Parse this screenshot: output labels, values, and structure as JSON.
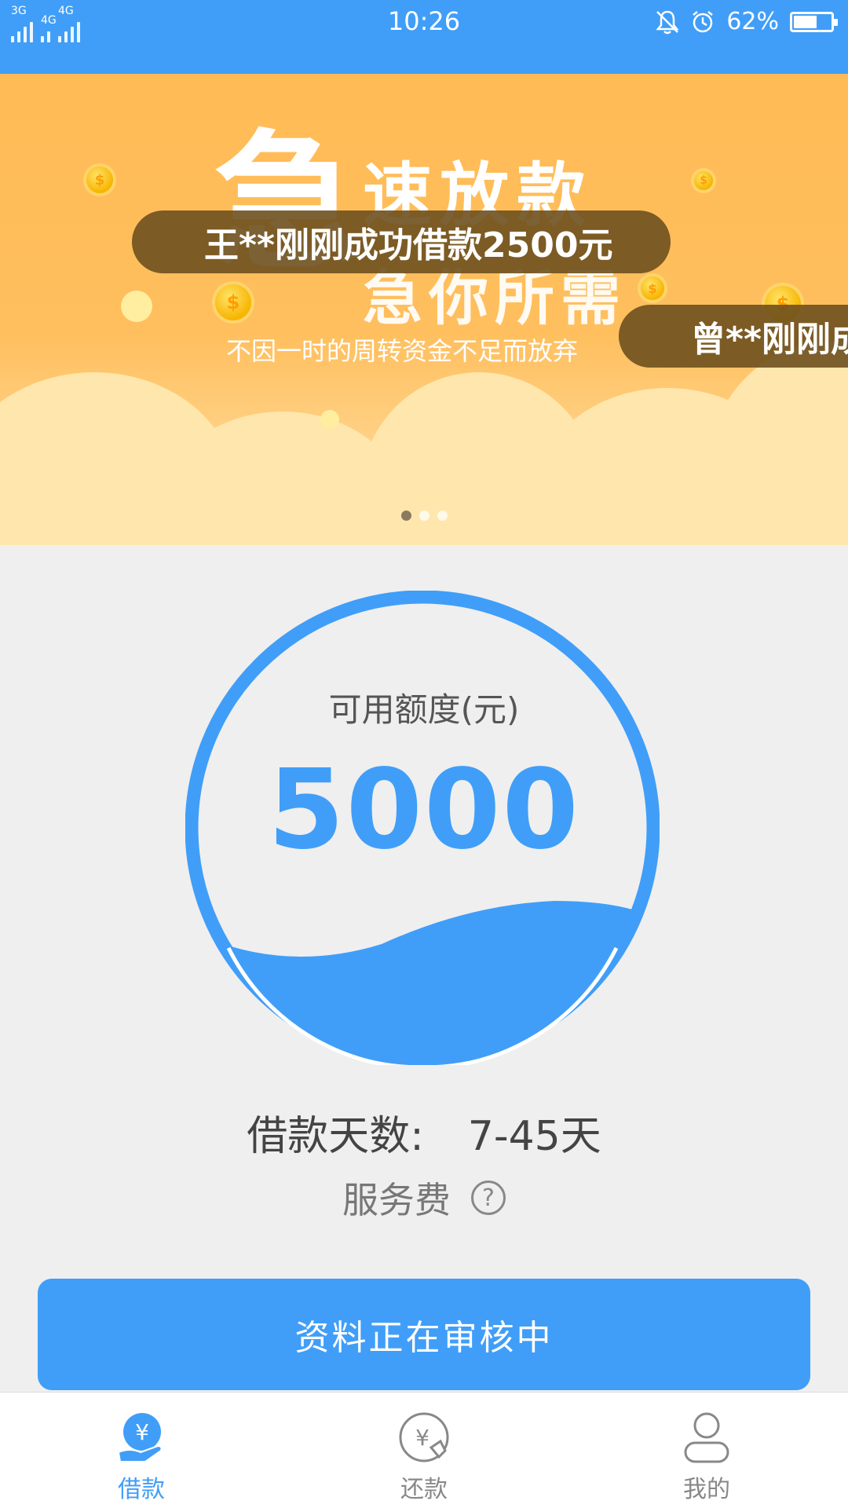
{
  "status_bar": {
    "signal_tag_1": "3G",
    "signal_tag_2": "4G",
    "signal_tag_3": "4G",
    "time": "10:26",
    "battery_percent": "62%",
    "battery_level": 0.62,
    "icons": [
      "bell-off-icon",
      "alarm-icon"
    ]
  },
  "banner": {
    "big_char": "急",
    "title": "速放款",
    "subtitle": "急你所需",
    "description": "不因一时的周转资金不足而放弃",
    "tickers": [
      "王**刚刚成功借款2500元",
      "曾**刚刚成"
    ],
    "page_count": 3,
    "active_page": 0
  },
  "credit": {
    "label": "可用额度(元)",
    "amount": "5000"
  },
  "loan_days": {
    "label": "借款天数:",
    "value": "7-45天"
  },
  "fee": {
    "label": "服务费",
    "help_symbol": "?"
  },
  "action": {
    "label": "资料正在审核中"
  },
  "nav": {
    "items": [
      {
        "label": "借款",
        "icon": "yen-hand-icon",
        "active": true
      },
      {
        "label": "还款",
        "icon": "yen-return-icon",
        "active": false
      },
      {
        "label": "我的",
        "icon": "user-icon",
        "active": false
      }
    ]
  },
  "colors": {
    "primary": "#409ef8",
    "banner": "#ffbb55"
  }
}
